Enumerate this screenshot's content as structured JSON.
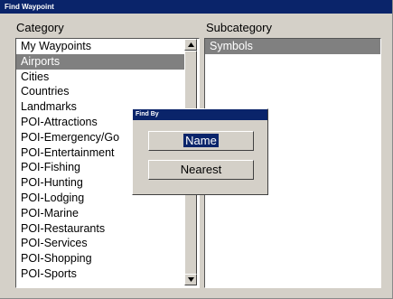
{
  "window": {
    "title": "Find Waypoint"
  },
  "category": {
    "header": "Category",
    "items": [
      "My Waypoints",
      "Airports",
      "Cities",
      "Countries",
      "Landmarks",
      "POI-Attractions",
      "POI-Emergency/Go",
      "POI-Entertainment",
      "POI-Fishing",
      "POI-Hunting",
      "POI-Lodging",
      "POI-Marine",
      "POI-Restaurants",
      "POI-Services",
      "POI-Shopping",
      "POI-Sports"
    ],
    "selected": "Airports"
  },
  "subcategory": {
    "header": "Subcategory",
    "items": [
      "Symbols"
    ],
    "selected": "Symbols"
  },
  "dialog": {
    "title": "Find By",
    "name_label": "Name",
    "nearest_label": "Nearest"
  },
  "icons": {
    "scroll_up": "triangle-up-icon",
    "scroll_down": "triangle-down-icon"
  }
}
